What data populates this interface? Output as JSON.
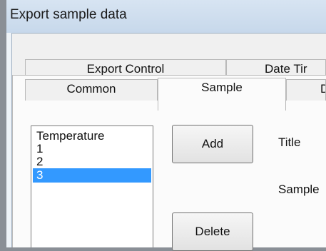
{
  "window": {
    "title": "Export sample data"
  },
  "tabs": {
    "back_row": [
      {
        "label": "Export Control"
      },
      {
        "label": "Date Tir"
      }
    ],
    "front_row": [
      {
        "label": "Common"
      },
      {
        "label": "Sample"
      },
      {
        "label": "D"
      }
    ],
    "selected": "Sample"
  },
  "sample_list": {
    "items": [
      {
        "label": "Temperature"
      },
      {
        "label": "1"
      },
      {
        "label": "2"
      },
      {
        "label": "3"
      }
    ],
    "selected_index": 3
  },
  "buttons": {
    "add_label": "Add",
    "delete_label": "Delete"
  },
  "fields": {
    "title_label": "Title",
    "sample_label": "Sample"
  },
  "colors": {
    "selection": "#3399ff",
    "titlebar": "#d7e4f2"
  }
}
